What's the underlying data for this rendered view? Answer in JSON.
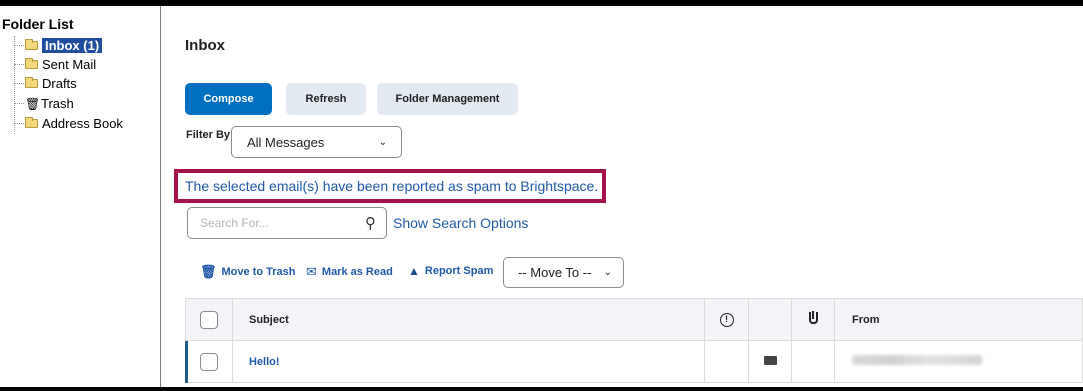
{
  "sidebar": {
    "title": "Folder List",
    "items": [
      {
        "label": "Inbox (1)",
        "icon": "folder-icon",
        "selected": true
      },
      {
        "label": "Sent Mail",
        "icon": "folder-icon"
      },
      {
        "label": "Drafts",
        "icon": "folder-icon"
      },
      {
        "label": "Trash",
        "icon": "trash-icon"
      },
      {
        "label": "Address Book",
        "icon": "folder-icon"
      }
    ]
  },
  "main": {
    "title": "Inbox",
    "buttons": {
      "compose": "Compose",
      "refresh": "Refresh",
      "folder_management": "Folder Management"
    },
    "filter": {
      "label": "Filter By:",
      "value": "All Messages"
    },
    "notice": "The selected email(s) have been reported as spam to Brightspace.",
    "search": {
      "placeholder": "Search For...",
      "options_link": "Show Search Options"
    },
    "actions": {
      "move_to_trash": "Move to Trash",
      "mark_as_read": "Mark as Read",
      "report_spam": "Report Spam",
      "move_to": "-- Move To --"
    },
    "table": {
      "headers": {
        "subject": "Subject",
        "from": "From"
      },
      "rows": [
        {
          "subject": "Hello!",
          "from_blurred": true,
          "unread": true
        }
      ]
    }
  },
  "colors": {
    "primary": "#006fbf",
    "link": "#1e5aa8",
    "notice_border": "#a3124a",
    "selected_folder": "#1f4f9c",
    "secondary_button": "#e3e9f1"
  }
}
